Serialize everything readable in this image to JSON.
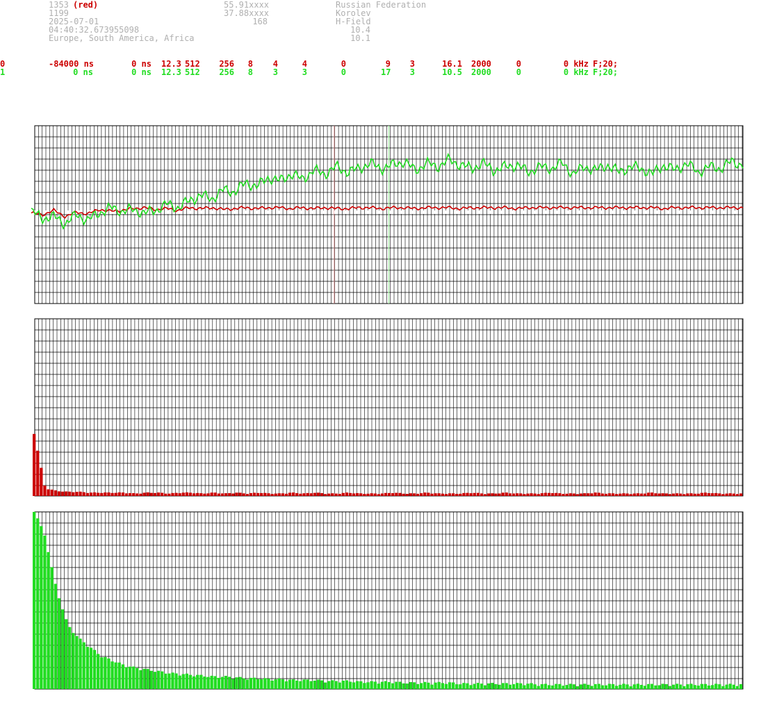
{
  "info": {
    "col1": [
      "1353",
      "1199",
      "2025-07-01",
      "04:40:32.673955098",
      "Europe, South America, Africa"
    ],
    "col1_tag": "(red)",
    "col2": [
      "55.91xxxx",
      "37.88xxxx",
      "168"
    ],
    "col3": [
      "Russian Federation",
      "Korolev",
      "H-Field"
    ],
    "col3_values": [
      "10.4",
      "10.1"
    ]
  },
  "rows": [
    {
      "id": "0",
      "offset": "-84000 ns",
      "f1": "0 ns",
      "f2": "12.3",
      "f3": "512",
      "f4": "256",
      "f5": "8",
      "f6": "4",
      "f7": "4",
      "f8": "0",
      "f9": "9",
      "f10": "3",
      "f11": "16.1",
      "f12": "2000",
      "f13": "0",
      "f14": "0 kHz",
      "f15": "F;20;"
    },
    {
      "id": "1",
      "offset": "0 ns",
      "f1": "0 ns",
      "f2": "12.3",
      "f3": "512",
      "f4": "256",
      "f5": "8",
      "f6": "3",
      "f7": "3",
      "f8": "0",
      "f9": "17",
      "f10": "3",
      "f11": "10.5",
      "f12": "2000",
      "f13": "0",
      "f14": "0 kHz",
      "f15": "F;20;"
    }
  ],
  "colors": {
    "red": "#cc0000",
    "green": "#22dd22",
    "grid": "#000000",
    "marker_red": "#ffaaaa",
    "marker_green": "#99ff99"
  },
  "chart_data": [
    {
      "type": "line",
      "series": [
        {
          "values": [
            -6,
            -8,
            -3,
            -10,
            -5,
            -7,
            -2,
            -4,
            -3,
            -1,
            0,
            -2,
            -1,
            -3,
            0,
            -1,
            0,
            -2,
            -1,
            0,
            -1,
            0,
            0,
            -1,
            0,
            -1,
            0,
            -1,
            -1,
            0,
            0,
            -1,
            0,
            0,
            -1,
            0,
            0,
            0,
            -1,
            0,
            0,
            0,
            0,
            -1,
            0,
            0,
            0,
            0,
            0,
            0,
            0,
            0,
            0,
            0,
            0,
            0,
            -1,
            0,
            0,
            0,
            0,
            0,
            0,
            0
          ]
        },
        {
          "values": [
            -4,
            -12,
            -10,
            -18,
            -8,
            -14,
            -6,
            0,
            -4,
            -2,
            -6,
            -3,
            4,
            0,
            8,
            14,
            10,
            20,
            18,
            28,
            24,
            34,
            30,
            38,
            32,
            42,
            38,
            46,
            40,
            44,
            50,
            44,
            48,
            52,
            42,
            50,
            46,
            54,
            48,
            44,
            50,
            42,
            46,
            48,
            40,
            46,
            44,
            50,
            38,
            46,
            42,
            48,
            40,
            46,
            44,
            38,
            48,
            42,
            50,
            40,
            46,
            44,
            52,
            48
          ]
        }
      ],
      "markers": [
        0.415,
        0.5
      ],
      "ylim": [
        -100,
        100
      ]
    },
    {
      "type": "bar",
      "series": [
        {
          "values": [
            70,
            8,
            5,
            4,
            4,
            3,
            3,
            3,
            3,
            2,
            3,
            3,
            2,
            3,
            3,
            2,
            3,
            2,
            3,
            2,
            3,
            2,
            2,
            3,
            2,
            3,
            2,
            2,
            3,
            2,
            2,
            2,
            3,
            2,
            2,
            3,
            2,
            2,
            2,
            3,
            2,
            2,
            3,
            2,
            2,
            2,
            3,
            2,
            2,
            2,
            3,
            2,
            2,
            2,
            2,
            3,
            2,
            2,
            2,
            2,
            3,
            2,
            2,
            2
          ]
        }
      ],
      "ylim": [
        0,
        200
      ]
    },
    {
      "type": "bar",
      "series": [
        {
          "values": [
            200,
            170,
            110,
            70,
            55,
            45,
            35,
            30,
            25,
            22,
            20,
            18,
            16,
            15,
            14,
            13,
            12,
            12,
            11,
            10,
            10,
            9,
            9,
            8,
            8,
            8,
            7,
            7,
            7,
            6,
            6,
            6,
            6,
            5,
            5,
            5,
            5,
            5,
            4,
            4,
            4,
            4,
            4,
            4,
            4,
            3,
            3,
            3,
            3,
            3,
            3,
            3,
            3,
            3,
            3,
            3,
            3,
            3,
            3,
            3,
            3,
            3,
            3,
            3
          ]
        }
      ],
      "ylim": [
        0,
        200
      ]
    }
  ]
}
